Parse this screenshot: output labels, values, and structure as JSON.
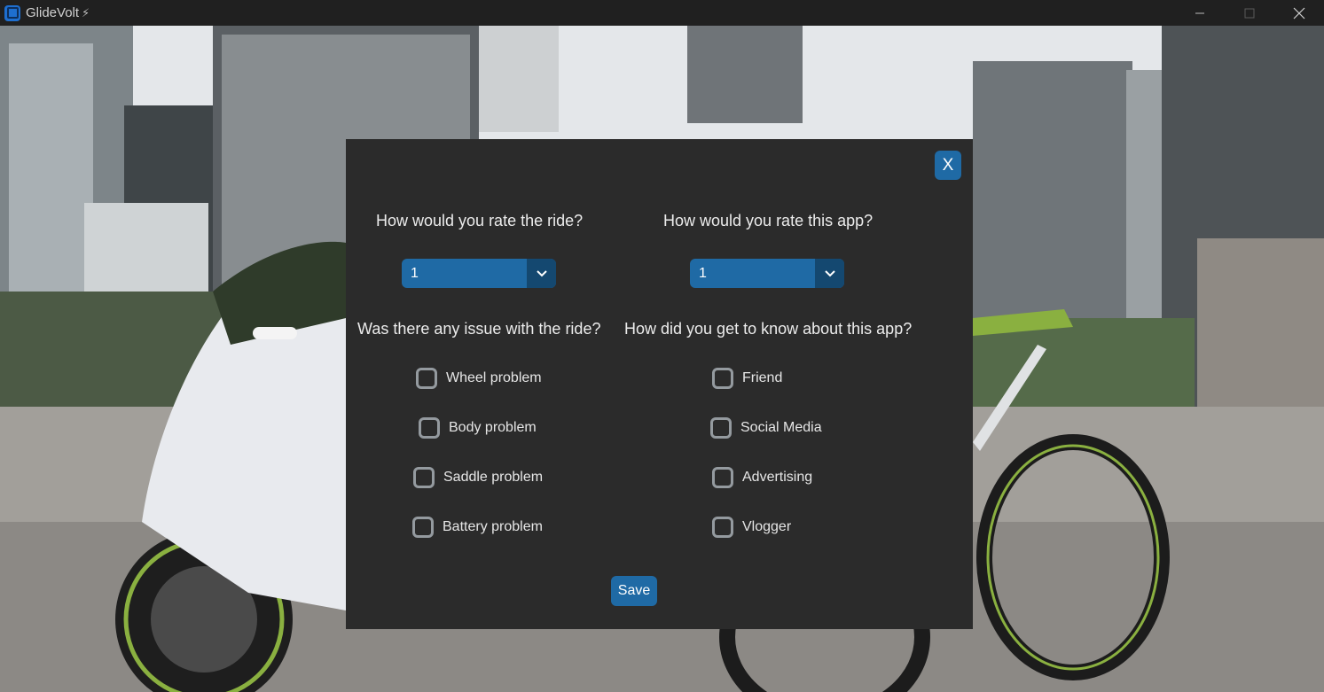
{
  "window": {
    "title": "GlideVolt",
    "title_icon": "lightning-bolt-icon",
    "controls": [
      "minimize",
      "maximize",
      "close"
    ]
  },
  "background": {
    "description_icon": "scooter-and-ebike-city-photo"
  },
  "dialog": {
    "close_label": "X",
    "ride_rating": {
      "question": "How would you rate the ride?",
      "value": "1"
    },
    "app_rating": {
      "question": "How would you rate this app?",
      "value": "1"
    },
    "ride_issues": {
      "question": "Was there any issue with the ride?",
      "options": [
        {
          "label": "Wheel problem",
          "checked": false
        },
        {
          "label": "Body problem",
          "checked": false
        },
        {
          "label": "Saddle problem",
          "checked": false
        },
        {
          "label": "Battery problem",
          "checked": false
        }
      ]
    },
    "discovery": {
      "question": "How did you get to know about this app?",
      "options": [
        {
          "label": "Friend",
          "checked": false
        },
        {
          "label": "Social Media",
          "checked": false
        },
        {
          "label": "Advertising",
          "checked": false
        },
        {
          "label": "Vlogger",
          "checked": false
        }
      ]
    },
    "save_label": "Save"
  },
  "colors": {
    "accent": "#1f6aa5",
    "accent_dark": "#144870",
    "dialog_bg": "#2b2b2b",
    "titlebar_bg": "#202020"
  }
}
